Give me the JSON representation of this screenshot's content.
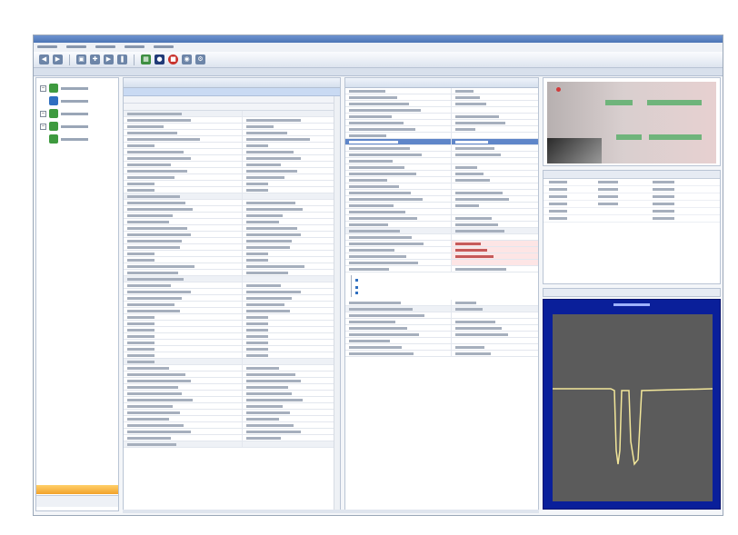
{
  "window": {
    "title": ""
  },
  "menu": {
    "items": [
      "",
      "",
      "",
      "",
      ""
    ]
  },
  "toolbar": {
    "buttons": [
      {
        "icon": "back-arrow-icon"
      },
      {
        "icon": "forward-arrow-icon"
      },
      {
        "icon": "image-icon"
      },
      {
        "icon": "move-icon"
      },
      {
        "icon": "play-icon"
      },
      {
        "icon": "pause-icon"
      },
      {
        "icon": "grid-icon"
      },
      {
        "icon": "record-icon"
      },
      {
        "icon": "stop-icon"
      },
      {
        "icon": "camera-icon"
      },
      {
        "icon": "settings-icon"
      }
    ]
  },
  "tree": {
    "nodes": [
      {
        "label": "",
        "selected": false
      },
      {
        "label": "",
        "selected": true
      },
      {
        "label": "",
        "selected": false
      },
      {
        "label": "",
        "selected": false
      },
      {
        "label": "",
        "selected": false
      }
    ]
  },
  "properties": {
    "title": "",
    "rows_placeholder": true
  },
  "inspector": {
    "title": ""
  },
  "preview": {
    "title": ""
  },
  "results_table": {
    "headers": [
      "",
      "",
      ""
    ]
  },
  "plot": {
    "title": ""
  },
  "colors": {
    "selection": "#c9daf3",
    "plot_background": "#0a1f9a",
    "plot_trace": "#f3e79a"
  }
}
